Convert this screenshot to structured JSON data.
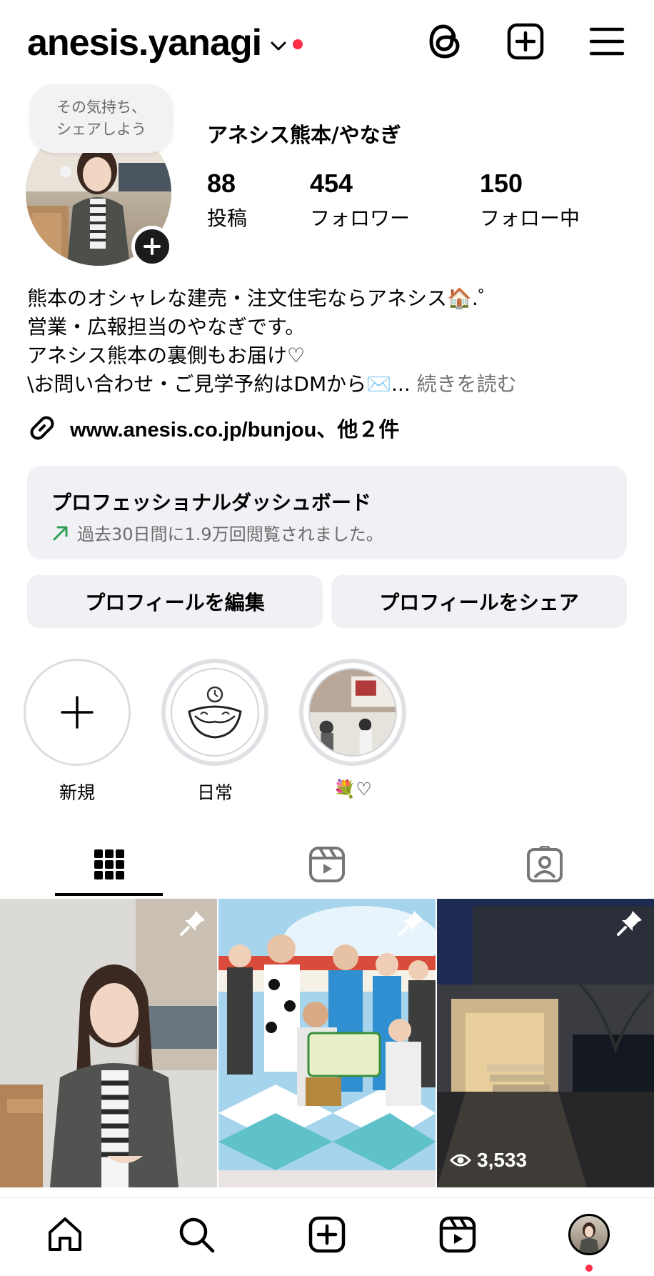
{
  "header": {
    "username": "anesis.yanagi",
    "icons": [
      "threads-icon",
      "create-post-icon",
      "menu-icon"
    ]
  },
  "profile": {
    "note_bubble": "その気持ち、\nシェアしよう",
    "display_name": "アネシス熊本/やなぎ",
    "stats": [
      {
        "value": "88",
        "label": "投稿"
      },
      {
        "value": "454",
        "label": "フォロワー"
      },
      {
        "value": "150",
        "label": "フォロー中"
      }
    ],
    "bio_lines": [
      "熊本のオシャレな建売・注文住宅ならアネシス🏠.゜",
      "営業・広報担当のやなぎです。",
      "アネシス熊本の裏側もお届け♡",
      "\\お問い合わせ・ご見学予約はDMから✉️..."
    ],
    "bio_more": " 続きを読む",
    "link": "www.anesis.co.jp/bunjou、他２件"
  },
  "dashboard": {
    "title": "プロフェッショナルダッシュボード",
    "subtitle": "過去30日間に1.9万回閲覧されました。"
  },
  "buttons": {
    "edit": "プロフィールを編集",
    "share": "プロフィールをシェア"
  },
  "highlights": [
    {
      "label": "新規"
    },
    {
      "label": "日常"
    },
    {
      "label": "💐♡"
    }
  ],
  "tabs": [
    "grid-tab",
    "reels-tab",
    "tagged-tab"
  ],
  "posts": [
    {
      "pinned": true,
      "views": ""
    },
    {
      "pinned": true,
      "views": ""
    },
    {
      "pinned": true,
      "views": "3,533"
    }
  ],
  "colors": {
    "accent_red": "#ff2d45",
    "panel_bg": "#eff1f4",
    "trend_green": "#2f9e58"
  }
}
